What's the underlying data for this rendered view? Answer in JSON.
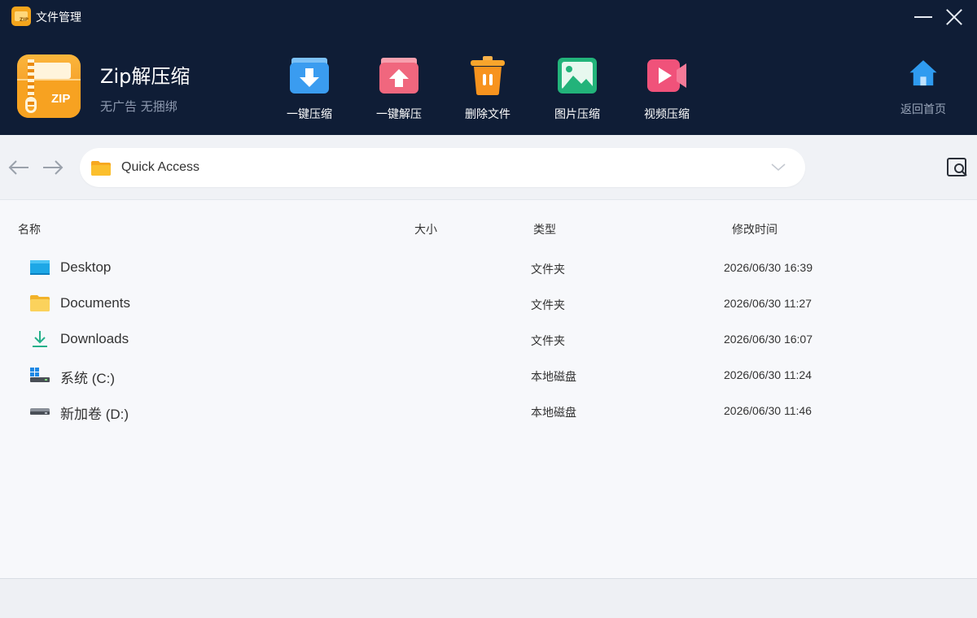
{
  "window": {
    "title": "文件管理"
  },
  "app": {
    "name": "Zip解压缩",
    "tagline": "无广告 无捆绑",
    "logo_text": "ZIP"
  },
  "toolbar": [
    {
      "label": "一键压缩",
      "icon": "compress-icon",
      "color": "#3a9cf0"
    },
    {
      "label": "一键解压",
      "icon": "extract-icon",
      "color": "#f0677e"
    },
    {
      "label": "删除文件",
      "icon": "trash-icon",
      "color": "#f7931e"
    },
    {
      "label": "图片压缩",
      "icon": "image-icon",
      "color": "#22b37a"
    },
    {
      "label": "视频压缩",
      "icon": "video-icon",
      "color": "#f0527a"
    }
  ],
  "home": {
    "label": "返回首页",
    "icon": "home-icon",
    "color": "#2f9bf0"
  },
  "address": {
    "path": "Quick Access"
  },
  "columns": {
    "name": "名称",
    "size": "大小",
    "type": "类型",
    "modified": "修改时间"
  },
  "files": [
    {
      "name": "Desktop",
      "type": "文件夹",
      "modified": "2026/06/30 16:39",
      "icon": "desktop-icon"
    },
    {
      "name": "Documents",
      "type": "文件夹",
      "modified": "2026/06/30 11:27",
      "icon": "folder-icon"
    },
    {
      "name": "Downloads",
      "type": "文件夹",
      "modified": "2026/06/30 16:07",
      "icon": "download-icon"
    },
    {
      "name": "系统 (C:)",
      "type": "本地磁盘",
      "modified": "2026/06/30 11:24",
      "icon": "system-drive-icon"
    },
    {
      "name": "新加卷 (D:)",
      "type": "本地磁盘",
      "modified": "2026/06/30 11:46",
      "icon": "drive-icon"
    }
  ],
  "colors": {
    "header_bg": "#0f1d36",
    "body_bg": "#f7f8fb",
    "folder": "#f9b52a"
  }
}
